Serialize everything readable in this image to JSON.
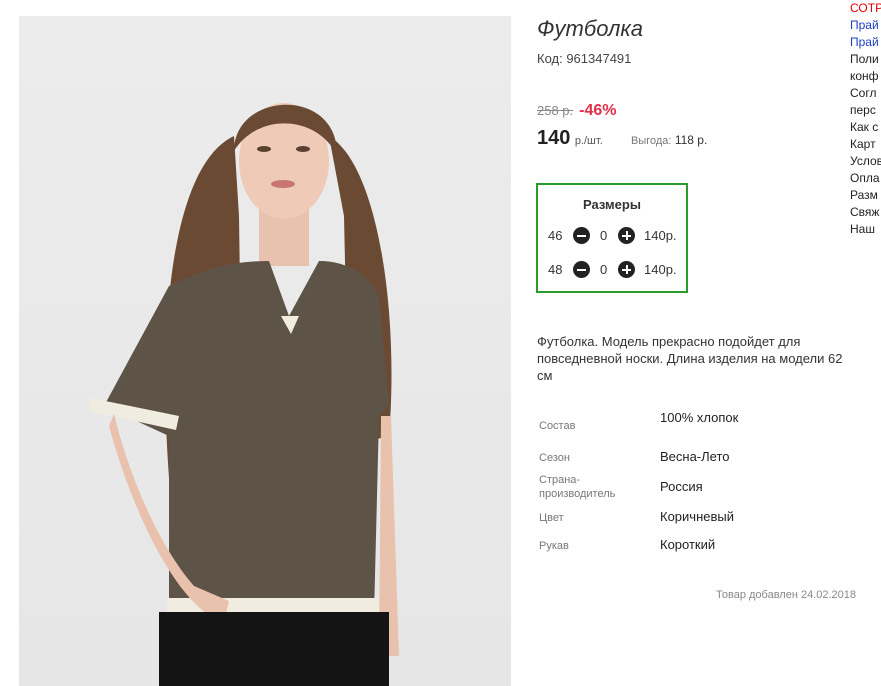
{
  "product": {
    "title": "Футболка",
    "code": "Код: 961347491",
    "old_price": "258 р.",
    "discount": "-46%",
    "price": "140",
    "price_unit": "р./шт.",
    "benefit_label": "Выгода:",
    "benefit_value": "118 р."
  },
  "sizes": {
    "title": "Размеры",
    "rows": [
      {
        "size": "46",
        "qty": "0",
        "price": "140р."
      },
      {
        "size": "48",
        "qty": "0",
        "price": "140р."
      }
    ]
  },
  "description": "Футболка. Модель прекрасно подойдет для повседневной носки. Длина изделия на модели 62 см",
  "properties": [
    {
      "label": "Состав",
      "value": "100% хлопок"
    },
    {
      "label": "Сезон",
      "value": "Весна-Лето"
    },
    {
      "label": "Страна-производитель",
      "value": "Россия"
    },
    {
      "label": "Цвет",
      "value": "Коричневый"
    },
    {
      "label": "Рукав",
      "value": "Короткий"
    }
  ],
  "added_date": "Товар добавлен 24.02.2018",
  "side_links": [
    "СОТР",
    "Прай",
    "Прай",
    "Поли",
    "конф",
    "Согл",
    "перс",
    "Как с",
    "Карт",
    "Услов",
    "Опла",
    "Разм",
    "Свяж",
    "Наш"
  ],
  "colors": {
    "accent_red": "#e0304a",
    "box_border": "#2a9a2a",
    "link_blue": "#1a3cc8"
  }
}
